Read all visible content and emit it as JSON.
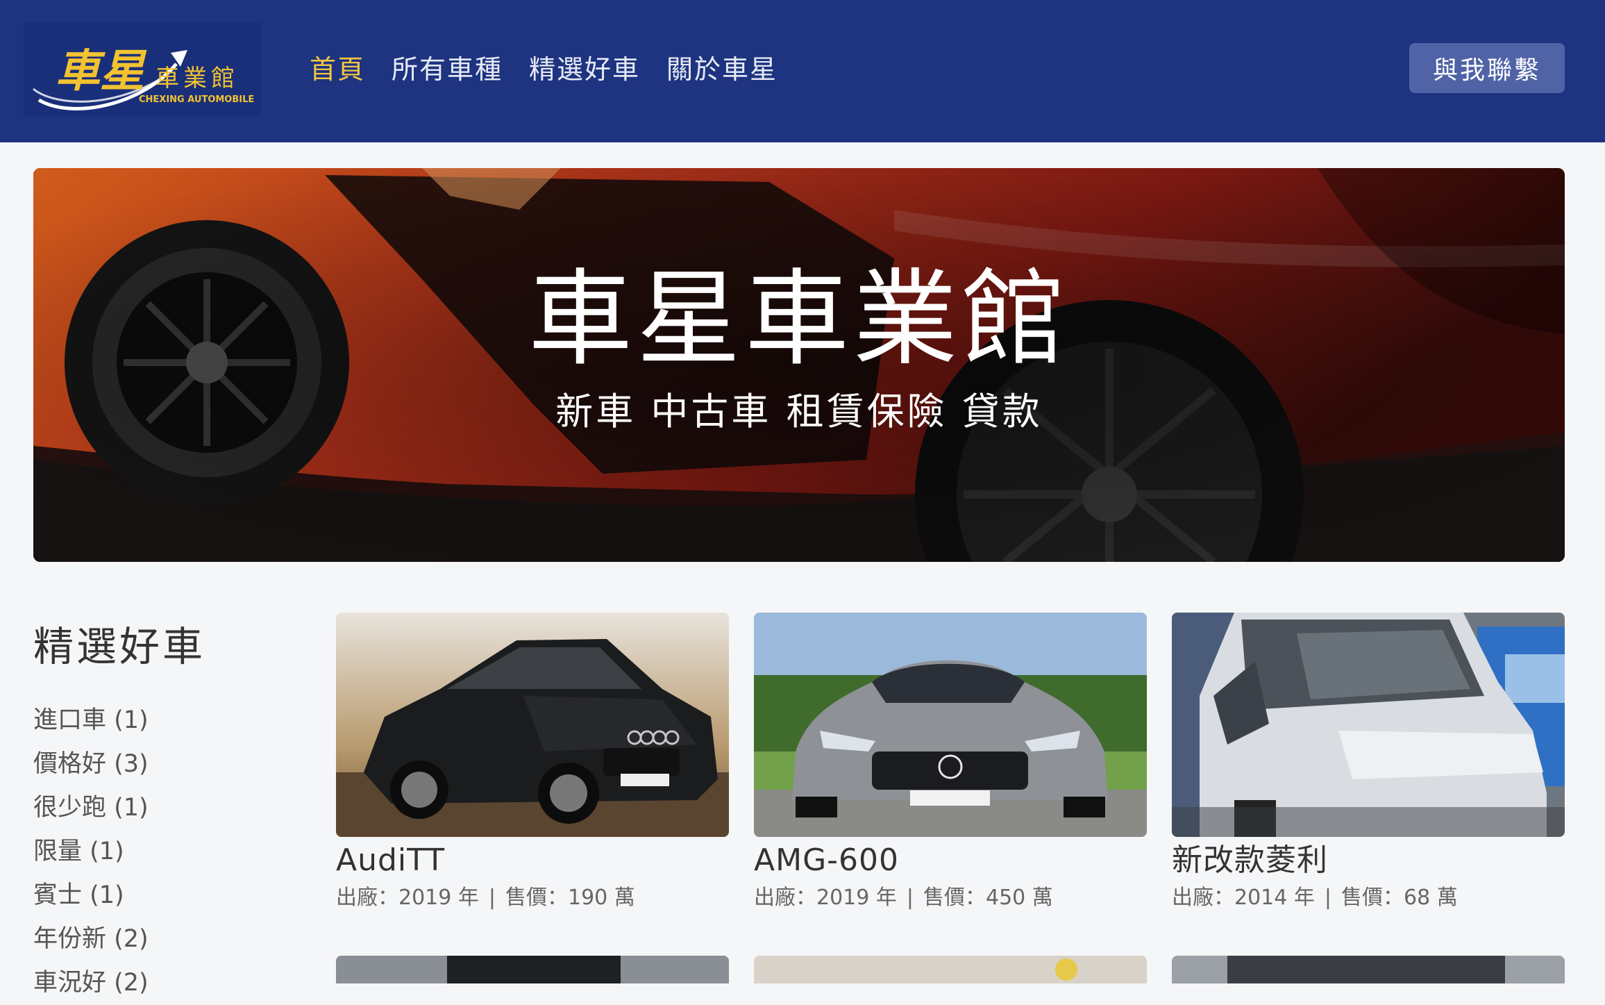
{
  "header": {
    "logo": {
      "mark": "車星",
      "name": "車業館",
      "tagline": "CHEXING AUTOMOBILE"
    },
    "nav": [
      {
        "label": "首頁",
        "active": true
      },
      {
        "label": "所有車種",
        "active": false
      },
      {
        "label": "精選好車",
        "active": false
      },
      {
        "label": "關於車星",
        "active": false
      }
    ],
    "contact_label": "與我聯繫"
  },
  "hero": {
    "title": "車星車業館",
    "subtitle": "新車 中古車 租賃保險 貸款"
  },
  "sidebar": {
    "title": "精選好車",
    "items": [
      {
        "label": "進口車 (1)"
      },
      {
        "label": "價格好 (3)"
      },
      {
        "label": "很少跑 (1)"
      },
      {
        "label": "限量 (1)"
      },
      {
        "label": "賓士 (1)"
      },
      {
        "label": "年份新 (2)"
      },
      {
        "label": "車況好 (2)"
      }
    ]
  },
  "cars": [
    {
      "name": "AudiTT",
      "year": "出廠：2019 年",
      "price": "售價：190 萬"
    },
    {
      "name": "AMG-600",
      "year": "出廠：2019 年",
      "price": "售價：450 萬"
    },
    {
      "name": "新改款菱利",
      "year": "出廠：2014 年",
      "price": "售價：68 萬"
    }
  ],
  "colors": {
    "header_bg": "#1e3480",
    "nav_active": "#f4c542",
    "contact_bg": "#4f63a6",
    "logo_gold": "#f2c230"
  }
}
